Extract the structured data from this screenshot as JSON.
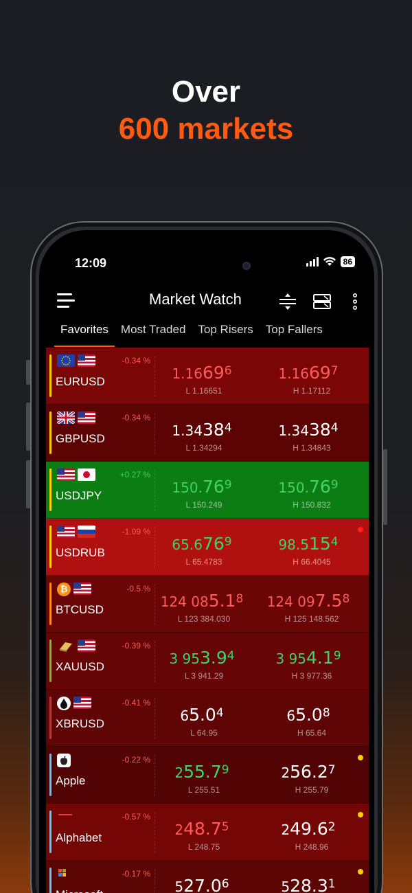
{
  "headline": {
    "line1": "Over",
    "line2": "600 markets"
  },
  "status": {
    "time": "12:09",
    "battery": "86"
  },
  "appbar": {
    "title": "Market Watch"
  },
  "tabs": [
    "Favorites",
    "Most Traded",
    "Top Risers",
    "Top Fallers"
  ],
  "colors": {
    "accent": "#ff5a12",
    "up": "#3fd36a",
    "down": "#ff5a5a",
    "flat": "#ffffff"
  },
  "rows": [
    {
      "symbol": "EURUSD",
      "change": "-0.34 %",
      "bid": [
        "1.16",
        "69",
        "6"
      ],
      "ask": [
        "1.16",
        "69",
        "7"
      ],
      "low": "L 1.16651",
      "high": "H 1.17112",
      "bg": "#7a0606",
      "stripe": "#ffd000",
      "tone": "down",
      "icons": [
        "eu-flag-icon",
        "us-flag-icon"
      ],
      "dot": ""
    },
    {
      "symbol": "GBPUSD",
      "change": "-0.34 %",
      "bid": [
        "1.34",
        "38",
        "4"
      ],
      "ask": [
        "1.34",
        "38",
        "4"
      ],
      "low": "L 1.34294",
      "high": "H 1.34843",
      "bg": "#5c0404",
      "stripe": "#ffd000",
      "tone": "flat",
      "icons": [
        "uk-flag-icon",
        "us-flag-icon"
      ],
      "dot": ""
    },
    {
      "symbol": "USDJPY",
      "change": "+0.27 %",
      "bid": [
        "150.",
        "76",
        "9"
      ],
      "ask": [
        "150.",
        "76",
        "9"
      ],
      "low": "L 150.249",
      "high": "H 150.832",
      "bg": "#0c7d12",
      "stripe": "#ffd000",
      "tone": "up",
      "icons": [
        "us-flag-icon",
        "jp-flag-icon"
      ],
      "dot": ""
    },
    {
      "symbol": "USDRUB",
      "change": "-1.09 %",
      "bid": [
        "65.6",
        "76",
        "9"
      ],
      "ask": [
        "98.5",
        "15",
        "4"
      ],
      "low": "L 65.4783",
      "high": "H 66.4045",
      "bg": "#b0100f",
      "stripe": "#ffd000",
      "tone": "up",
      "icons": [
        "us-flag-icon",
        "ru-flag-icon"
      ],
      "dot": "#ff2020"
    },
    {
      "symbol": "BTCUSD",
      "change": "-0.5 %",
      "bid": [
        "124 08",
        "5.1",
        "8"
      ],
      "ask": [
        "124 09",
        "7.5",
        "8"
      ],
      "low": "L 123 384.030",
      "high": "H 125 148.562",
      "bg": "#6a0606",
      "stripe": "#ff8a1a",
      "tone": "down",
      "icons": [
        "bitcoin-icon",
        "us-flag-icon"
      ],
      "dot": ""
    },
    {
      "symbol": "XAUUSD",
      "change": "-0.39 %",
      "bid": [
        "3 95",
        "3.9",
        "4"
      ],
      "ask": [
        "3 95",
        "4.1",
        "9"
      ],
      "low": "L 3 941.29",
      "high": "H 3 977.36",
      "bg": "#650505",
      "stripe": "#9aa04a",
      "tone": "up",
      "icons": [
        "gold-bar-icon",
        "us-flag-icon"
      ],
      "dot": ""
    },
    {
      "symbol": "XBRUSD",
      "change": "-0.41 %",
      "bid": [
        "6",
        "5.0",
        "4"
      ],
      "ask": [
        "6",
        "5.0",
        "8"
      ],
      "low": "L 64.95",
      "high": "H 65.64",
      "bg": "#600505",
      "stripe": "#b04040",
      "tone": "flat",
      "icons": [
        "oil-drop-icon",
        "us-flag-icon"
      ],
      "dot": ""
    },
    {
      "symbol": "Apple",
      "change": "-0.22 %",
      "bid": [
        "2",
        "55.7",
        "9"
      ],
      "ask": [
        "2",
        "56.2",
        "7"
      ],
      "low": "L 255.51",
      "high": "H 255.79",
      "bg": "#520404",
      "stripe": "#8ab4d0",
      "tone": "up",
      "askTone": "flat",
      "icons": [
        "apple-logo-icon"
      ],
      "dot": "#ffd000"
    },
    {
      "symbol": "Alphabet",
      "change": "-0.57 %",
      "bid": [
        "2",
        "48.7",
        "5"
      ],
      "ask": [
        "2",
        "49.6",
        "2"
      ],
      "low": "L 248.75",
      "high": "H 248.96",
      "bg": "#750606",
      "stripe": "#8ab4d0",
      "tone": "down",
      "askTone": "flat",
      "icons": [
        "alphabet-logo-icon"
      ],
      "dot": "#ffd000"
    },
    {
      "symbol": "Microsoft",
      "change": "-0.17 %",
      "bid": [
        "5",
        "27.0",
        "6"
      ],
      "ask": [
        "5",
        "28.3",
        "1"
      ],
      "low": "",
      "high": "",
      "bg": "#5c0505",
      "stripe": "#8ab4d0",
      "tone": "flat",
      "icons": [
        "microsoft-logo-icon"
      ],
      "dot": "#ffd000"
    }
  ]
}
